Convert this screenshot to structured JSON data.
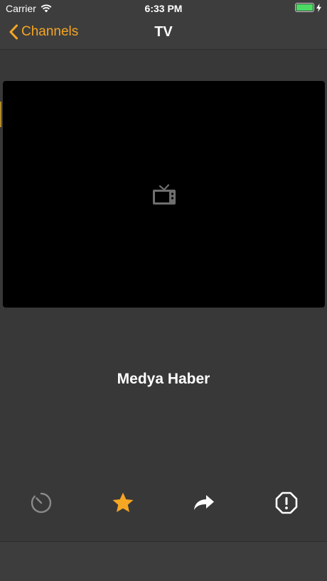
{
  "status_bar": {
    "carrier": "Carrier",
    "time": "6:33 PM"
  },
  "nav": {
    "back_label": "Channels",
    "title": "TV"
  },
  "player": {
    "placeholder_icon": "tv-icon"
  },
  "channel": {
    "name": "Medya Haber"
  },
  "actions": [
    {
      "name": "timer",
      "icon": "timer-icon",
      "enabled": false
    },
    {
      "name": "favorite",
      "icon": "star-icon",
      "active": true
    },
    {
      "name": "share",
      "icon": "share-arrow-icon"
    },
    {
      "name": "report",
      "icon": "alert-octagon-icon"
    }
  ],
  "colors": {
    "accent": "#f5a623",
    "background": "#383838",
    "bar": "#3d3d3d",
    "battery": "#4cd964",
    "disabled": "#8a8a8a"
  }
}
